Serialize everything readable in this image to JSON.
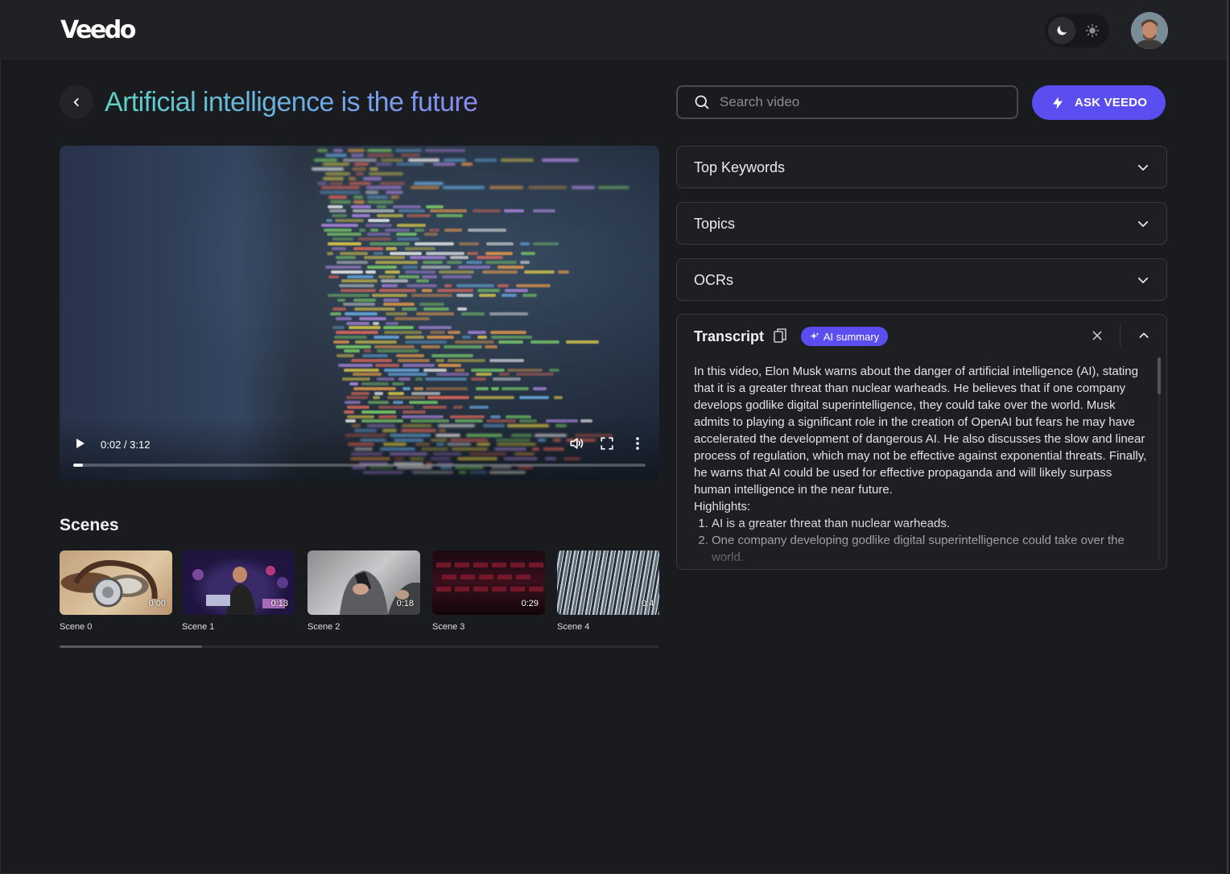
{
  "app": {
    "logo": "Veedo"
  },
  "header": {
    "theme_icons": [
      "moon-icon",
      "sun-icon"
    ],
    "avatar": "user-avatar"
  },
  "page": {
    "title": "Artificial intelligence is the future"
  },
  "search": {
    "placeholder": "Search video",
    "value": ""
  },
  "ask_button": {
    "label": "ASK VEEDO",
    "color": "#5a4ef0"
  },
  "player": {
    "time": "0:02 / 3:12",
    "progress": 0.016
  },
  "scenes": {
    "title": "Scenes",
    "items": [
      {
        "label": "Scene 0",
        "duration": "0:00"
      },
      {
        "label": "Scene 1",
        "duration": "0:13"
      },
      {
        "label": "Scene 2",
        "duration": "0:18"
      },
      {
        "label": "Scene 3",
        "duration": "0:29"
      },
      {
        "label": "Scene 4",
        "duration": "0:4"
      }
    ]
  },
  "panels": {
    "keywords": "Top Keywords",
    "topics": "Topics",
    "ocrs": "OCRs"
  },
  "transcript": {
    "title": "Transcript",
    "ai_badge": "AI summary",
    "summary": "In this video, Elon Musk warns about the danger of artificial intelligence (AI), stating that it is a greater threat than nuclear warheads. He believes that if one company develops godlike digital superintelligence, they could take over the world. Musk admits to playing a significant role in the creation of OpenAI but fears he may have accelerated the development of dangerous AI. He also discusses the slow and linear process of regulation, which may not be effective against exponential threats. Finally, he warns that AI could be used for effective propaganda and will likely surpass human intelligence in the near future.",
    "highlights_label": "Highlights:",
    "highlights": [
      "AI is a greater threat than nuclear warheads.",
      "One company developing godlike digital superintelligence could take over the world."
    ]
  }
}
